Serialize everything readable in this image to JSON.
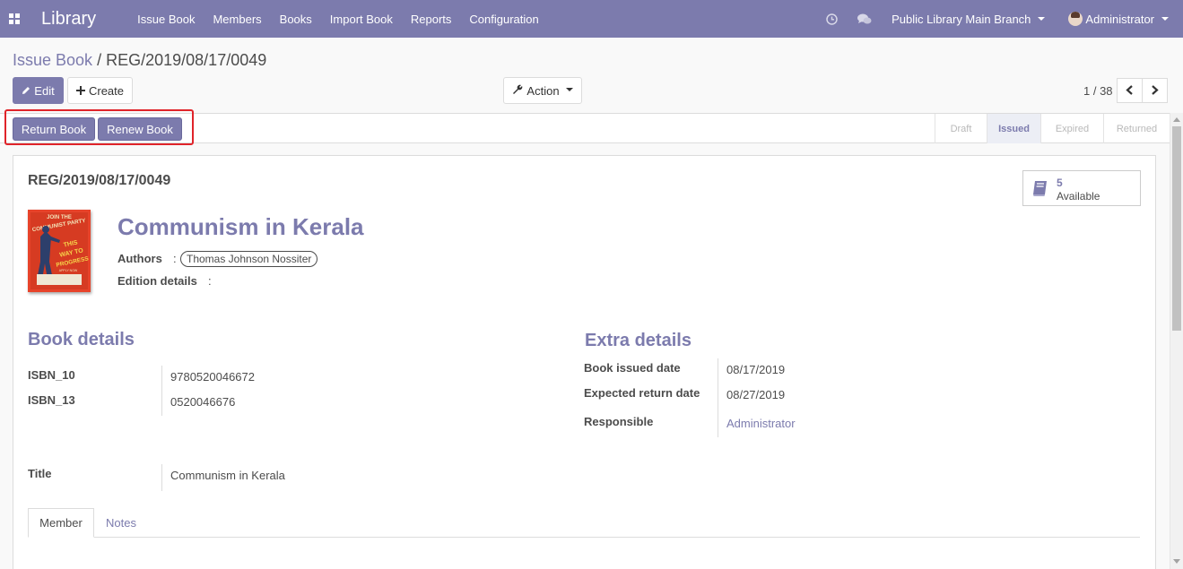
{
  "navbar": {
    "app_title": "Library",
    "menu": [
      "Issue Book",
      "Members",
      "Books",
      "Import Book",
      "Reports",
      "Configuration"
    ],
    "branch": "Public Library Main Branch",
    "user": "Administrator",
    "icons": [
      "apps-icon",
      "clock-icon",
      "chat-icon"
    ],
    "bg_color": "#7c7bad"
  },
  "breadcrumb": {
    "parent": "Issue Book",
    "separator": "/",
    "current": "REG/2019/08/17/0049"
  },
  "toolbar": {
    "edit_label": "Edit",
    "create_label": "Create",
    "action_label": "Action"
  },
  "pager": {
    "text": "1 / 38"
  },
  "statusbar": {
    "return_label": "Return Book",
    "renew_label": "Renew Book",
    "stages": [
      "Draft",
      "Issued",
      "Expired",
      "Returned"
    ],
    "active_stage": "Issued"
  },
  "form": {
    "reference": "REG/2019/08/17/0049",
    "smart_button": {
      "count": "5",
      "label": "Available"
    },
    "book_title": "Communism in Kerala",
    "cover_text": {
      "line1": "JOIN THE",
      "line2": "COMMUNIST PARTY",
      "line3": "THIS",
      "line4": "WAY TO",
      "line5": "PROGRESS",
      "line6": "APPLY NOW"
    },
    "authors_label": "Authors",
    "authors_colon": ":",
    "author_tag": "Thomas Johnson Nossiter",
    "edition_label": "Edition details",
    "edition_colon": ":",
    "book_details_heading": "Book details",
    "extra_details_heading": "Extra details",
    "isbn10_label": "ISBN_10",
    "isbn10_value": "9780520046672",
    "isbn13_label": "ISBN_13",
    "isbn13_value": "0520046676",
    "issued_date_label": "Book issued date",
    "issued_date_value": "08/17/2019",
    "return_date_label": "Expected return date",
    "return_date_value": "08/27/2019",
    "responsible_label": "Responsible",
    "responsible_value": "Administrator",
    "title_label": "Title",
    "title_value": "Communism in Kerala"
  },
  "tabs": [
    "Member",
    "Notes"
  ]
}
